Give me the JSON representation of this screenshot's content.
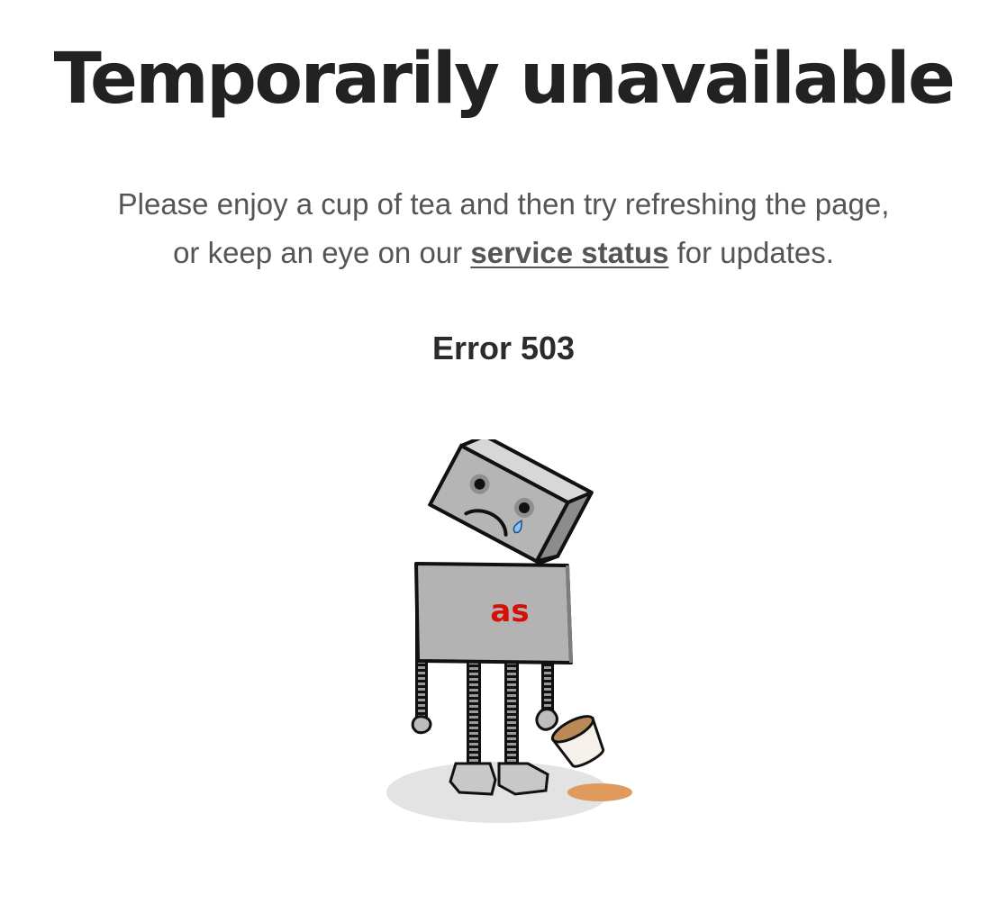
{
  "page": {
    "title": "Temporarily unavailable",
    "message": {
      "line1": "Please enjoy a cup of tea and then try refreshing the page,",
      "line2_before": "or keep an eye on our",
      "link_text": "service status",
      "line2_after": "for updates."
    },
    "error_code": "Error 503"
  },
  "illustration": {
    "robot_logo_text": "as",
    "colors": {
      "robot_body": "#b3b3b3",
      "outline": "#111111",
      "logo": "#d51007",
      "tea_spill": "#e09a5c",
      "shadow": "#e3e3e3"
    }
  }
}
